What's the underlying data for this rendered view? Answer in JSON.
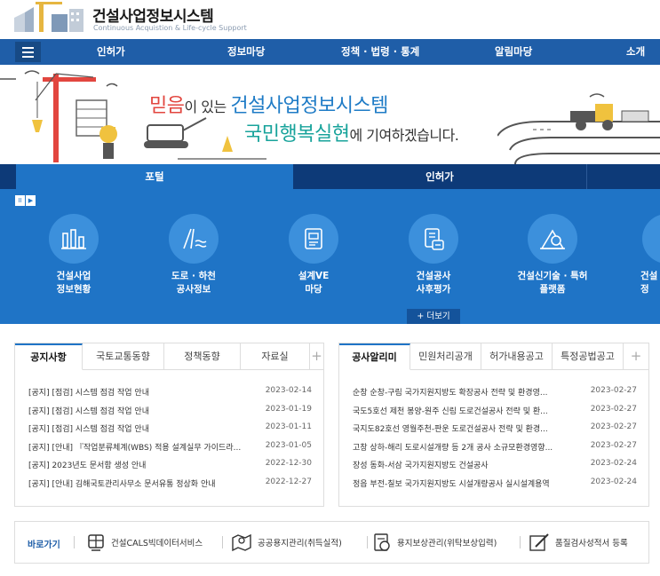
{
  "header": {
    "title": "건설사업정보시스템",
    "subtitle": "Continuous Acquistion & Life-cycle Support"
  },
  "gnb": {
    "items": [
      "인허가",
      "정보마당",
      "정책 · 법령 · 통계",
      "알림마당",
      "소개"
    ]
  },
  "banner": {
    "slogan1_red": "믿음",
    "slogan1_mid": "이 있는 ",
    "slogan1_blue": "건설사업정보시스템",
    "slogan2_teal": "국민행복실현",
    "slogan2_dark": "에 기여하겠습니다."
  },
  "portal": {
    "tabs": [
      "포털",
      "인허가"
    ],
    "controls": [
      "II",
      "▶"
    ],
    "services": [
      {
        "label": "건설사업\n정보현황",
        "icon": "bar-chart-icon"
      },
      {
        "label": "도로 · 하천\n공사정보",
        "icon": "road-river-icon"
      },
      {
        "label": "설계VE\n마당",
        "icon": "document-icon"
      },
      {
        "label": "건설공사\n사후평가",
        "icon": "evaluation-icon"
      },
      {
        "label": "건설신기술 · 특허\n플랫폼",
        "icon": "tech-patent-icon"
      },
      {
        "label": "건설\n정",
        "icon": "more-service-icon"
      }
    ],
    "more_label": "+ 더보기"
  },
  "board_left": {
    "tabs": [
      "공지사항",
      "국토교통동향",
      "정책동향",
      "자료실"
    ],
    "plus": "+",
    "rows": [
      {
        "title": "[공지] [점검] 시스템 점검 작업 안내",
        "date": "2023-02-14"
      },
      {
        "title": "[공지] [점검] 시스템 점검 작업 안내",
        "date": "2023-01-19"
      },
      {
        "title": "[공지] [점검] 시스템 점검 작업 안내",
        "date": "2023-01-11"
      },
      {
        "title": "[공지] [안내] 『작업분류체계(WBS) 적용 설계실무 가이드라...",
        "date": "2023-01-05"
      },
      {
        "title": "[공지] 2023년도 문서함 생성 안내",
        "date": "2022-12-30"
      },
      {
        "title": "[공지] [안내] 김해국토관리사무소 문서유통 정상화 안내",
        "date": "2022-12-27"
      }
    ]
  },
  "board_right": {
    "tabs": [
      "공사알리미",
      "민원처리공개",
      "허가내용공고",
      "특정공법공고"
    ],
    "plus": "+",
    "rows": [
      {
        "title": "순창 순창-구림 국가지원지방도 확장공사 전략 및 환경영...",
        "date": "2023-02-27"
      },
      {
        "title": "국도5호선 제천 봉양-원주 신림 도로건설공사 전략 및 환...",
        "date": "2023-02-27"
      },
      {
        "title": "국지도82호선 영월주천-판운 도로건설공사 전략 및 환경...",
        "date": "2023-02-27"
      },
      {
        "title": "고창 상하-해리 도로시설개량 등 2개 공사 소규모환경영향...",
        "date": "2023-02-27"
      },
      {
        "title": "장성 동화-서삼 국가지원지방도 건설공사",
        "date": "2023-02-24"
      },
      {
        "title": "정읍 부전-칠보 국가지원지방도 시설개량공사 실시설계용역",
        "date": "2023-02-24"
      }
    ]
  },
  "quick": {
    "label": "바로가기",
    "items": [
      {
        "label": "건설CALS빅데이터서비스",
        "icon": "big-data-icon"
      },
      {
        "label": "공공용지관리(취득실적)",
        "icon": "land-map-icon"
      },
      {
        "label": "용지보상관리(위탁보상입력)",
        "icon": "compensation-icon"
      },
      {
        "label": "품질검사성적서 등록",
        "icon": "quality-report-icon"
      }
    ]
  },
  "colors": {
    "gnb": "#1f5ea8",
    "portal": "#1f74c6",
    "tab_bar": "#0d3a78",
    "slogan_red": "#e2463f",
    "slogan_blue": "#1e7bc6",
    "slogan_teal": "#18a39b"
  }
}
